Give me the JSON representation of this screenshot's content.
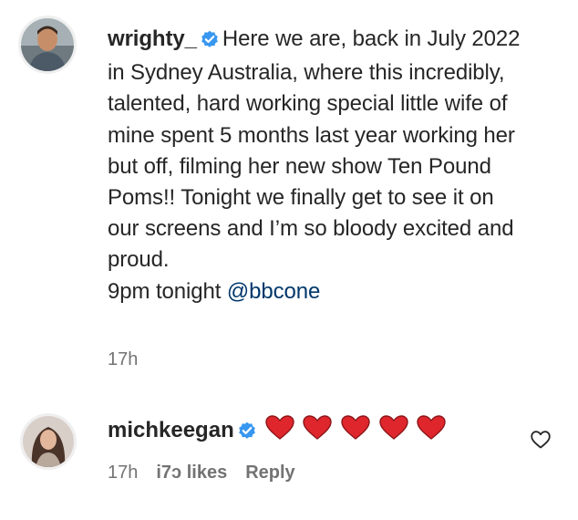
{
  "post": {
    "username": "wrighty_",
    "caption": "Here we are, back in July 2022 in Sydney Australia, where this incredibly, talented, hard working special little wife of mine spent 5 months last year working her but off, filming her new show Ten Pound Poms!! Tonight we finally get to see it on our screens and I’m so bloody excited and proud.",
    "line2_prefix": "9pm tonight ",
    "mention": "@bbcone",
    "time": "17h",
    "verified_icon": "verified-badge-icon",
    "accent_color": "#3897f0"
  },
  "comment": {
    "username": "michkeegan",
    "hearts_icon": "red-heart-emoji",
    "heart_color": "#e0262d",
    "time": "17h",
    "likes": "i7ɔ likes",
    "reply": "Reply",
    "like_icon": "heart-outline-icon"
  }
}
